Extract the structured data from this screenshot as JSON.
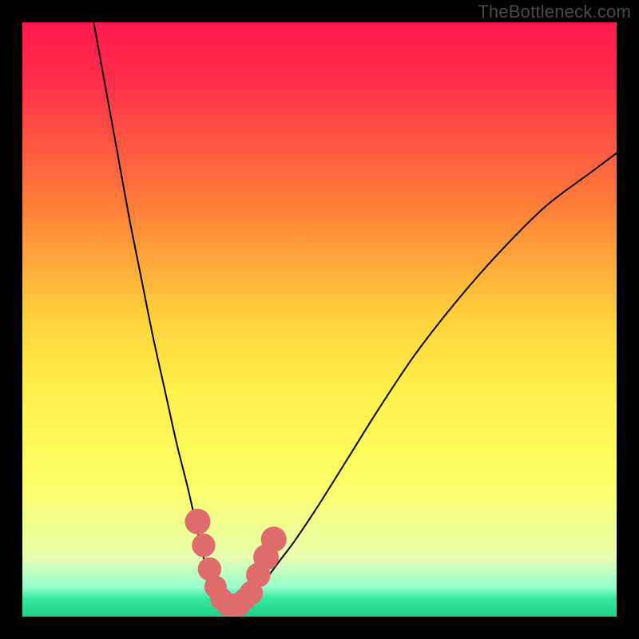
{
  "watermark": "TheBottleneck.com",
  "chart_data": {
    "type": "line",
    "title": "",
    "xlabel": "",
    "ylabel": "",
    "xlim": [
      0,
      100
    ],
    "ylim": [
      0,
      100
    ],
    "background_gradient": {
      "stops": [
        {
          "offset": 0.0,
          "color": "#ff1a4d"
        },
        {
          "offset": 0.1,
          "color": "#ff2e4a"
        },
        {
          "offset": 0.3,
          "color": "#ff7a3a"
        },
        {
          "offset": 0.5,
          "color": "#ffd23a"
        },
        {
          "offset": 0.62,
          "color": "#fff04a"
        },
        {
          "offset": 0.78,
          "color": "#fcff66"
        },
        {
          "offset": 0.9,
          "color": "#e8ffb0"
        },
        {
          "offset": 0.95,
          "color": "#98ffcf"
        },
        {
          "offset": 0.97,
          "color": "#35e9a0"
        },
        {
          "offset": 1.0,
          "color": "#1fd18a"
        }
      ]
    },
    "series": [
      {
        "name": "left-arm",
        "x": [
          12,
          14,
          16,
          18,
          20,
          22,
          24,
          26,
          28,
          30,
          31,
          32,
          33
        ],
        "y": [
          100,
          89,
          78,
          67,
          57,
          47,
          38,
          29,
          21,
          12,
          8,
          5,
          3
        ]
      },
      {
        "name": "right-arm",
        "x": [
          38,
          40,
          43,
          46,
          50,
          55,
          60,
          66,
          73,
          80,
          88,
          96,
          100
        ],
        "y": [
          3,
          5,
          9,
          13,
          19,
          27,
          35,
          44,
          53,
          61,
          69,
          75,
          78
        ]
      },
      {
        "name": "valley-floor",
        "x": [
          33,
          34,
          35,
          36,
          37,
          38
        ],
        "y": [
          3,
          2,
          2,
          2,
          2,
          3
        ]
      }
    ],
    "markers": [
      {
        "x": 29.5,
        "y": 16,
        "r": 1.8
      },
      {
        "x": 30.5,
        "y": 12,
        "r": 1.6
      },
      {
        "x": 31.5,
        "y": 8,
        "r": 1.6
      },
      {
        "x": 32.5,
        "y": 5,
        "r": 1.5
      },
      {
        "x": 33.5,
        "y": 3,
        "r": 1.5
      },
      {
        "x": 34.5,
        "y": 2,
        "r": 1.5
      },
      {
        "x": 35.5,
        "y": 2,
        "r": 1.5
      },
      {
        "x": 36.5,
        "y": 2,
        "r": 1.5
      },
      {
        "x": 37.5,
        "y": 3,
        "r": 1.5
      },
      {
        "x": 38.5,
        "y": 4,
        "r": 1.6
      },
      {
        "x": 39.7,
        "y": 7,
        "r": 1.7
      },
      {
        "x": 41.0,
        "y": 10,
        "r": 1.8
      },
      {
        "x": 42.3,
        "y": 13,
        "r": 1.8
      }
    ],
    "marker_color": "#e06b6b",
    "line_color": "#000000",
    "line_width": 2
  }
}
